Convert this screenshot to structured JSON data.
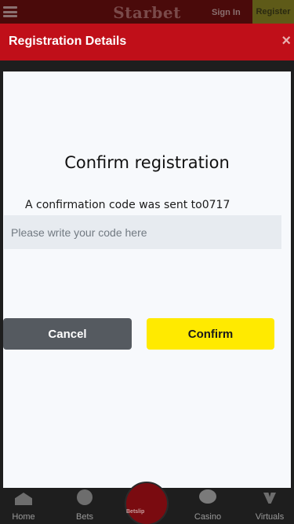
{
  "header": {
    "brand": "Starbet",
    "signin_label": "Sign In",
    "register_label": "Register"
  },
  "modal": {
    "title": "Registration Details",
    "close_glyph": "×",
    "heading": "Confirm registration",
    "message": "A confirmation code was sent to0717",
    "code_input": {
      "value": "",
      "placeholder": "Please write your code here"
    },
    "cancel_label": "Cancel",
    "confirm_label": "Confirm"
  },
  "bottom_nav": {
    "home": "Home",
    "bets": "Bets",
    "betslip": "Betslip",
    "casino": "Casino",
    "virtuals": "Virtuals"
  },
  "colors": {
    "modal_header": "#c00f19",
    "confirm_button": "#ffea00",
    "cancel_button": "#555a60"
  },
  "icons": [
    "menu-icon",
    "close-icon",
    "home-icon",
    "bets-icon",
    "casino-icon",
    "virtuals-icon"
  ]
}
